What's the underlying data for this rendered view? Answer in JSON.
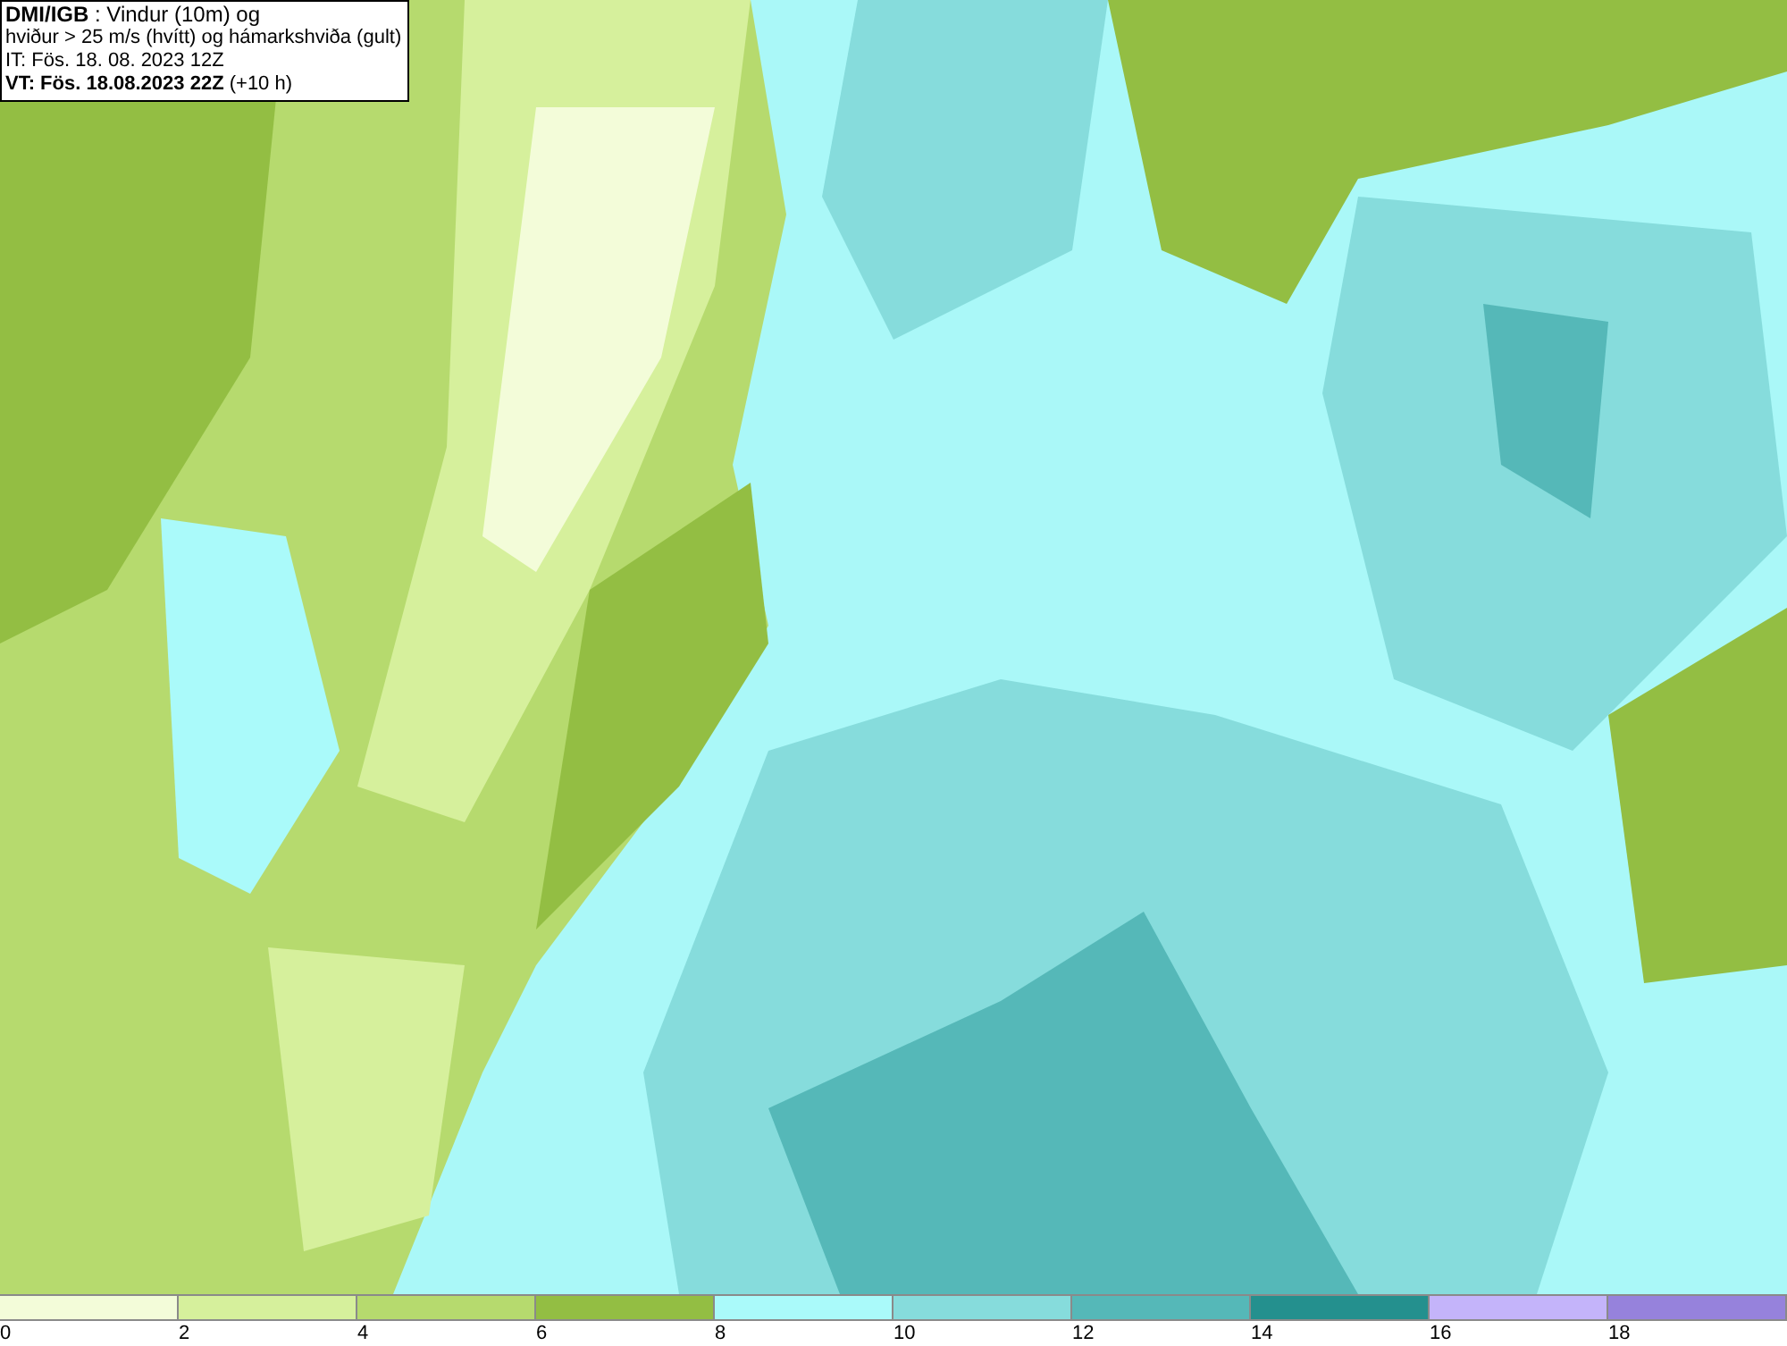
{
  "header": {
    "lines": [
      "**DMI/IGB** : Vindur (10m) og",
      "hviður > 25 m/s (hvítt) og hámarkshviða (gult)",
      "IT: Fös. 18. 08. 2023 12Z",
      "**VT: Fös. 18.08.2023 22Z** (+10 h)"
    ]
  },
  "legend": [
    {
      "label": "0",
      "color": "#f3fcd9"
    },
    {
      "label": "2",
      "color": "#d6f09c"
    },
    {
      "label": "4",
      "color": "#b6da6e"
    },
    {
      "label": "6",
      "color": "#93be43"
    },
    {
      "label": "8",
      "color": "#aafafa"
    },
    {
      "label": "10",
      "color": "#86dcdc"
    },
    {
      "label": "12",
      "color": "#55b8b8"
    },
    {
      "label": "14",
      "color": "#24908e"
    },
    {
      "label": "16",
      "color": "#c4b4fa"
    },
    {
      "label": "18",
      "color": "#9682dc"
    }
  ]
}
